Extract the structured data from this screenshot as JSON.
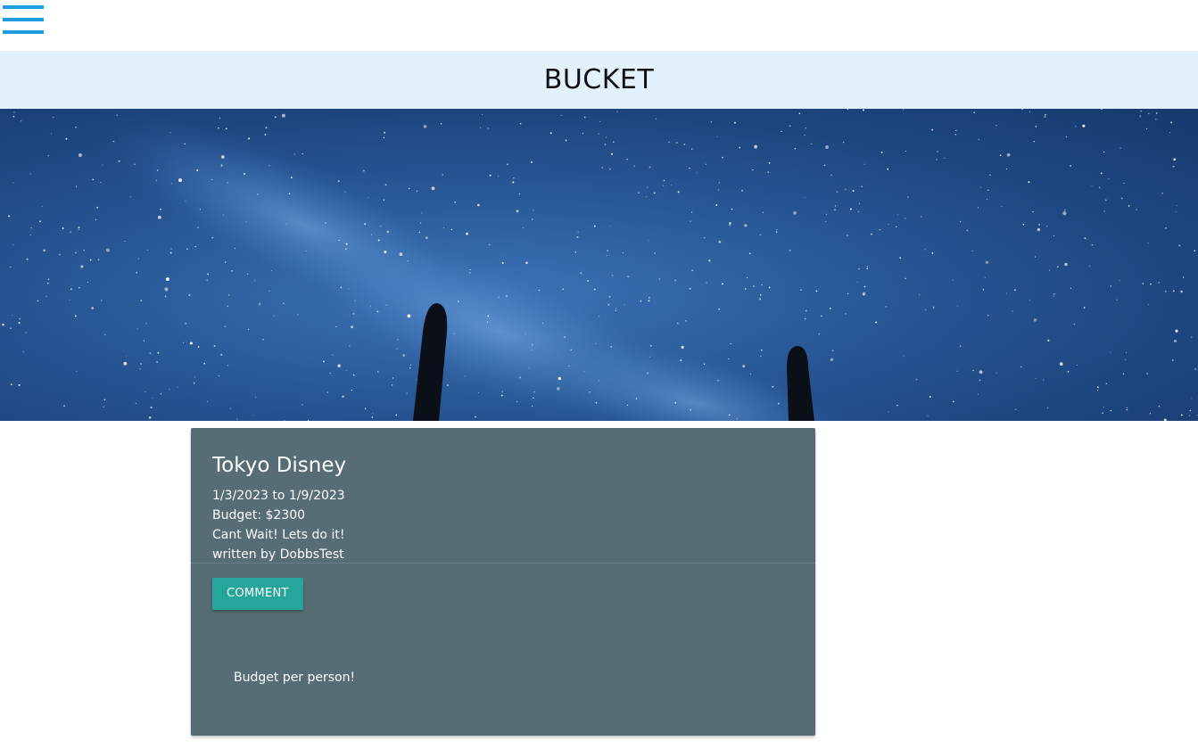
{
  "nav": {
    "menu_icon": "hamburger-menu-icon",
    "accent_color": "#1e9ce0"
  },
  "header": {
    "title": "BUCKET"
  },
  "hero": {
    "image": "starry-night-sky-with-cactus-silhouettes"
  },
  "post": {
    "title": "Tokyo Disney",
    "dates": "1/3/2023 to 1/9/2023",
    "budget": "Budget: $2300",
    "description": "Cant Wait! Lets do it!",
    "author": "written by DobbsTest",
    "comment_button_label": "COMMENT",
    "comments": [
      "Budget per person!"
    ],
    "card_color": "#566d76",
    "button_color": "#26a69a"
  }
}
